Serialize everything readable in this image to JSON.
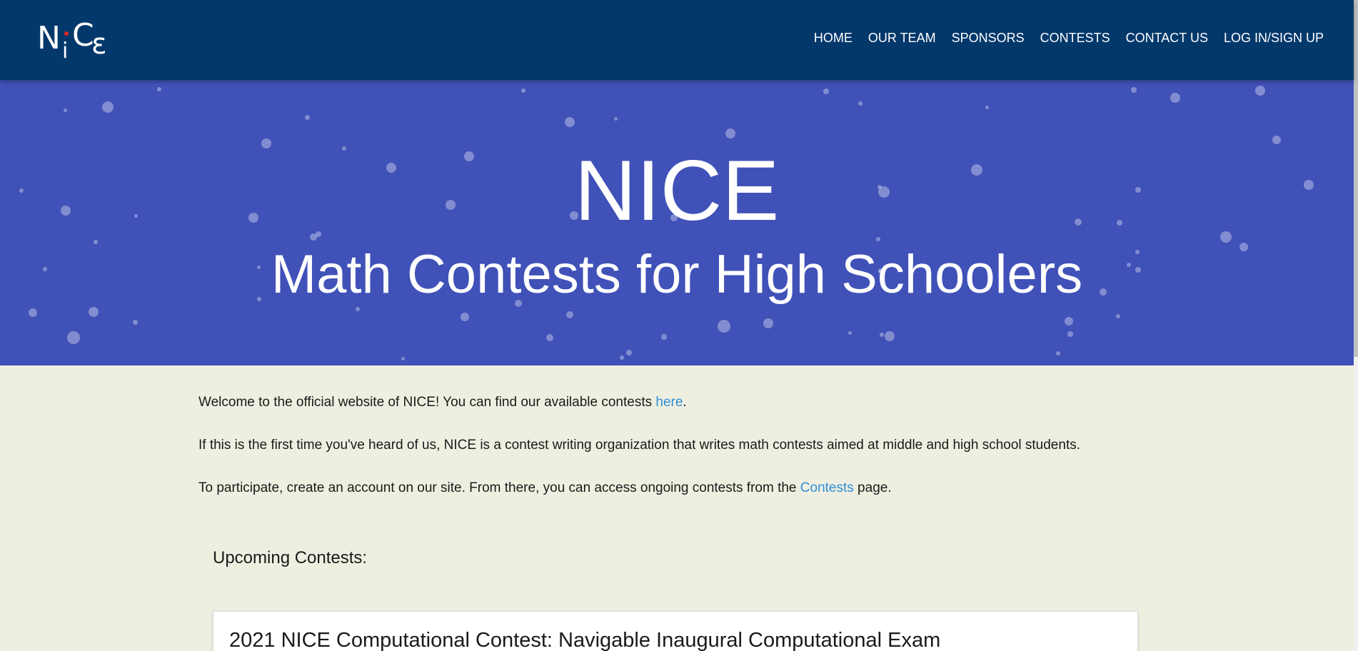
{
  "header": {
    "logo": {
      "n": "N",
      "i": "i",
      "c": "C",
      "e": "ε"
    },
    "nav": {
      "home": "HOME",
      "our_team": "OUR TEAM",
      "sponsors": "SPONSORS",
      "contests": "CONTESTS",
      "contact_us": "CONTACT US",
      "login": "LOG IN/SIGN UP"
    }
  },
  "hero": {
    "title": "NICE",
    "subtitle": "Math Contests for High Schoolers"
  },
  "content": {
    "p1_before": "Welcome to the official website of NICE! You can find our available contests ",
    "p1_link": "here",
    "p1_after": ".",
    "p2": "If this is the first time you've heard of us, NICE is a contest writing organization that writes math contests aimed at middle and high school students.",
    "p3_before": "To participate, create an account on our site. From there, you can access ongoing contests from the ",
    "p3_link": "Contests",
    "p3_after": " page.",
    "upcoming_heading": "Upcoming Contests:",
    "contests": [
      {
        "title": "2021 NICE Computational Contest: Navigable Inaugural Computational Exam"
      }
    ]
  },
  "colors": {
    "navbar": "#03386b",
    "hero": "#4051b8",
    "page_background": "#efefe1",
    "link": "#2f8fd9",
    "logo_dot": "#e32626"
  }
}
